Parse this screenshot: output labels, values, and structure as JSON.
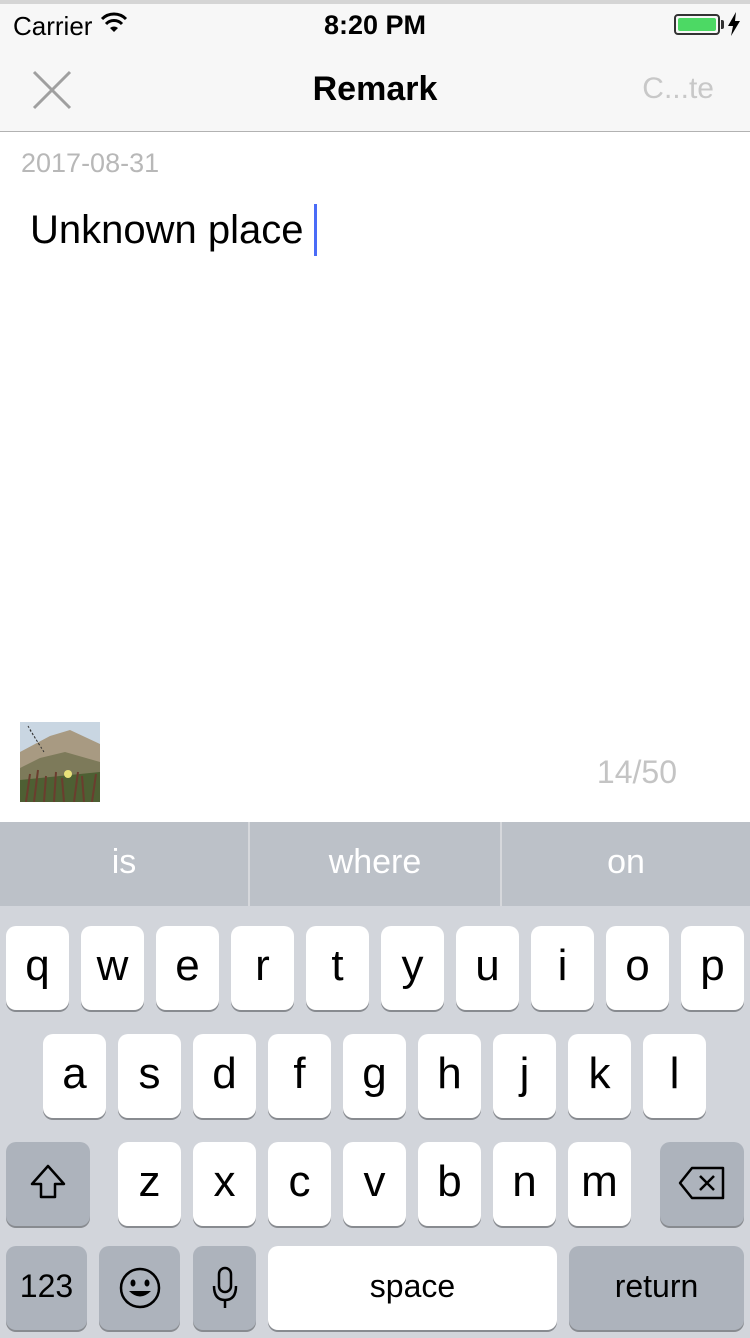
{
  "status_bar": {
    "carrier": "Carrier",
    "time": "8:20 PM",
    "battery_color": "#4cd964"
  },
  "nav_bar": {
    "title": "Remark",
    "action_label": "C...te",
    "close_icon": "close-icon"
  },
  "content": {
    "date": "2017-08-31",
    "text": "Unknown place",
    "counter": "14/50"
  },
  "keyboard": {
    "suggestions": [
      "is",
      "where",
      "on"
    ],
    "row1": [
      "q",
      "w",
      "e",
      "r",
      "t",
      "y",
      "u",
      "i",
      "o",
      "p"
    ],
    "row2": [
      "a",
      "s",
      "d",
      "f",
      "g",
      "h",
      "j",
      "k",
      "l"
    ],
    "row3": [
      "z",
      "x",
      "c",
      "v",
      "b",
      "n",
      "m"
    ],
    "numbers_label": "123",
    "space_label": "space",
    "return_label": "return",
    "shift_icon": "shift-icon",
    "delete_icon": "backspace-icon",
    "emoji_icon": "emoji-icon",
    "mic_icon": "microphone-icon"
  }
}
